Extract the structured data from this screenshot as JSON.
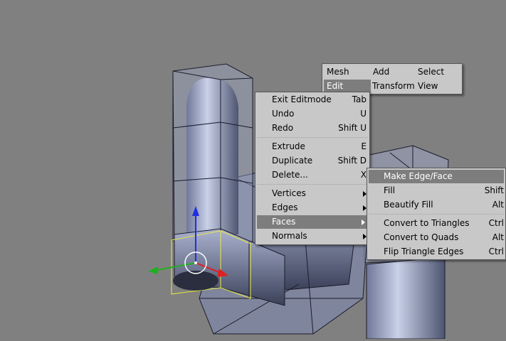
{
  "header_menu": {
    "row1": [
      "Mesh",
      "Add",
      "Select"
    ],
    "row2": [
      "Edit",
      "Transform",
      "View"
    ]
  },
  "edit_menu": {
    "items": [
      {
        "label": "Exit Editmode",
        "shortcut": "Tab"
      },
      {
        "label": "Undo",
        "shortcut": "U"
      },
      {
        "label": "Redo",
        "shortcut": "Shift U"
      },
      {
        "label": "Extrude",
        "shortcut": "E"
      },
      {
        "label": "Duplicate",
        "shortcut": "Shift D"
      },
      {
        "label": "Delete...",
        "shortcut": "X"
      },
      {
        "label": "Vertices",
        "shortcut": ""
      },
      {
        "label": "Edges",
        "shortcut": ""
      },
      {
        "label": "Faces",
        "shortcut": ""
      },
      {
        "label": "Normals",
        "shortcut": ""
      }
    ]
  },
  "faces_menu": {
    "items": [
      {
        "label": "Make Edge/Face",
        "shortcut": ""
      },
      {
        "label": "Fill",
        "shortcut": "Shift"
      },
      {
        "label": "Beautify Fill",
        "shortcut": "Alt"
      },
      {
        "label": "Convert to Triangles",
        "shortcut": "Ctrl"
      },
      {
        "label": "Convert to Quads",
        "shortcut": "Alt"
      },
      {
        "label": "Flip Triangle Edges",
        "shortcut": "Ctrl"
      }
    ]
  },
  "colors": {
    "viewport_bg": "#808080",
    "menu_bg": "#c8c8c8",
    "highlight": "#7d7d7d",
    "mesh": "#8f98b6",
    "axis_x": "#e02020",
    "axis_y": "#20b020",
    "axis_z": "#2030e0",
    "selection": "#e8e840"
  }
}
